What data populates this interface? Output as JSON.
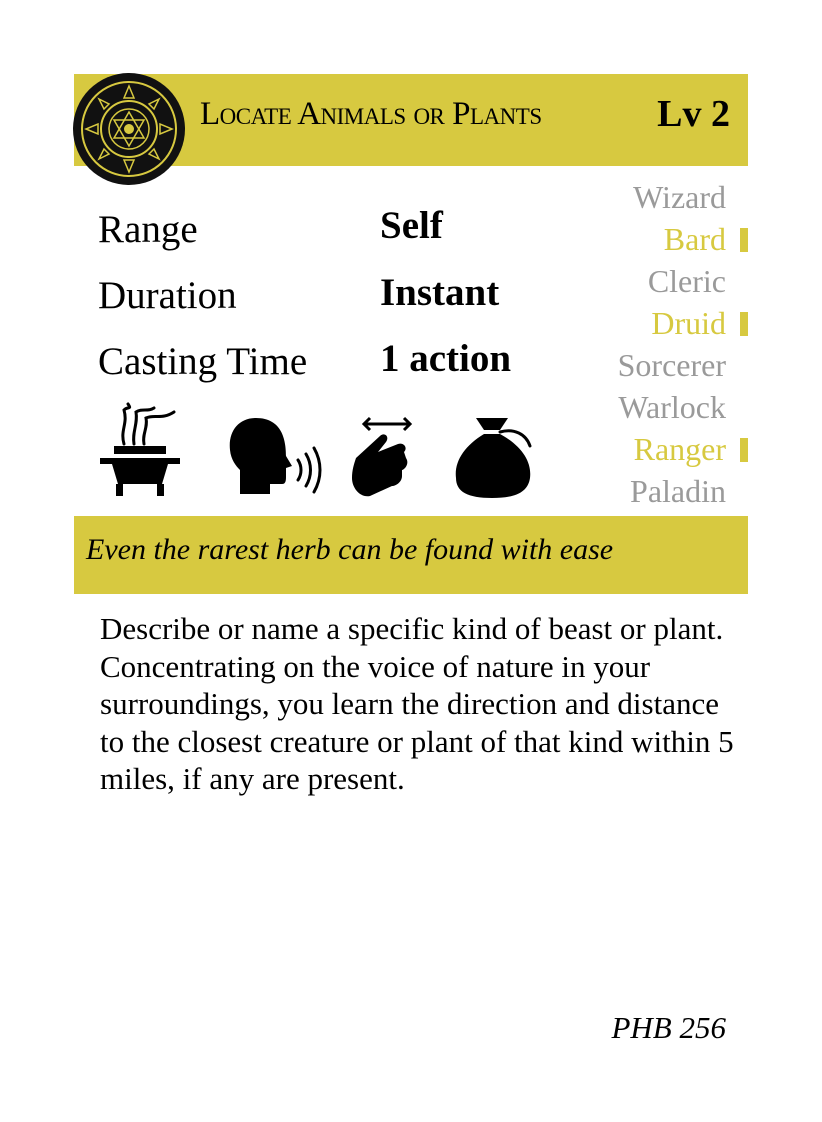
{
  "spell": {
    "title": "Locate Animals or Plants",
    "level": "Lv 2",
    "school_icon": "school-emblem-icon"
  },
  "stats": {
    "range": {
      "label": "Range",
      "value": "Self"
    },
    "duration": {
      "label": "Duration",
      "value": "Instant"
    },
    "casting_time": {
      "label": "Casting Time",
      "value": "1 action"
    }
  },
  "classes": [
    {
      "name": "Wizard",
      "active": false
    },
    {
      "name": "Bard",
      "active": true
    },
    {
      "name": "Cleric",
      "active": false
    },
    {
      "name": "Druid",
      "active": true
    },
    {
      "name": "Sorcerer",
      "active": false
    },
    {
      "name": "Warlock",
      "active": false
    },
    {
      "name": "Ranger",
      "active": true
    },
    {
      "name": "Paladin",
      "active": false
    }
  ],
  "components": [
    "ritual-brazier-icon",
    "verbal-speaking-head-icon",
    "somatic-hand-gesture-icon",
    "material-pouch-icon"
  ],
  "flavor": "Even the rarest herb can be found with ease",
  "description": "Describe or name a specific kind of beast or plant. Concentrating on the voice of nature in your surroundings, you learn the direction and distance to the closest creature or plant of that kind within 5 miles, if any are present.",
  "source": "PHB 256",
  "colors": {
    "accent": "#d7c940",
    "inactive_class": "#9a9a9a",
    "text": "#000000"
  }
}
